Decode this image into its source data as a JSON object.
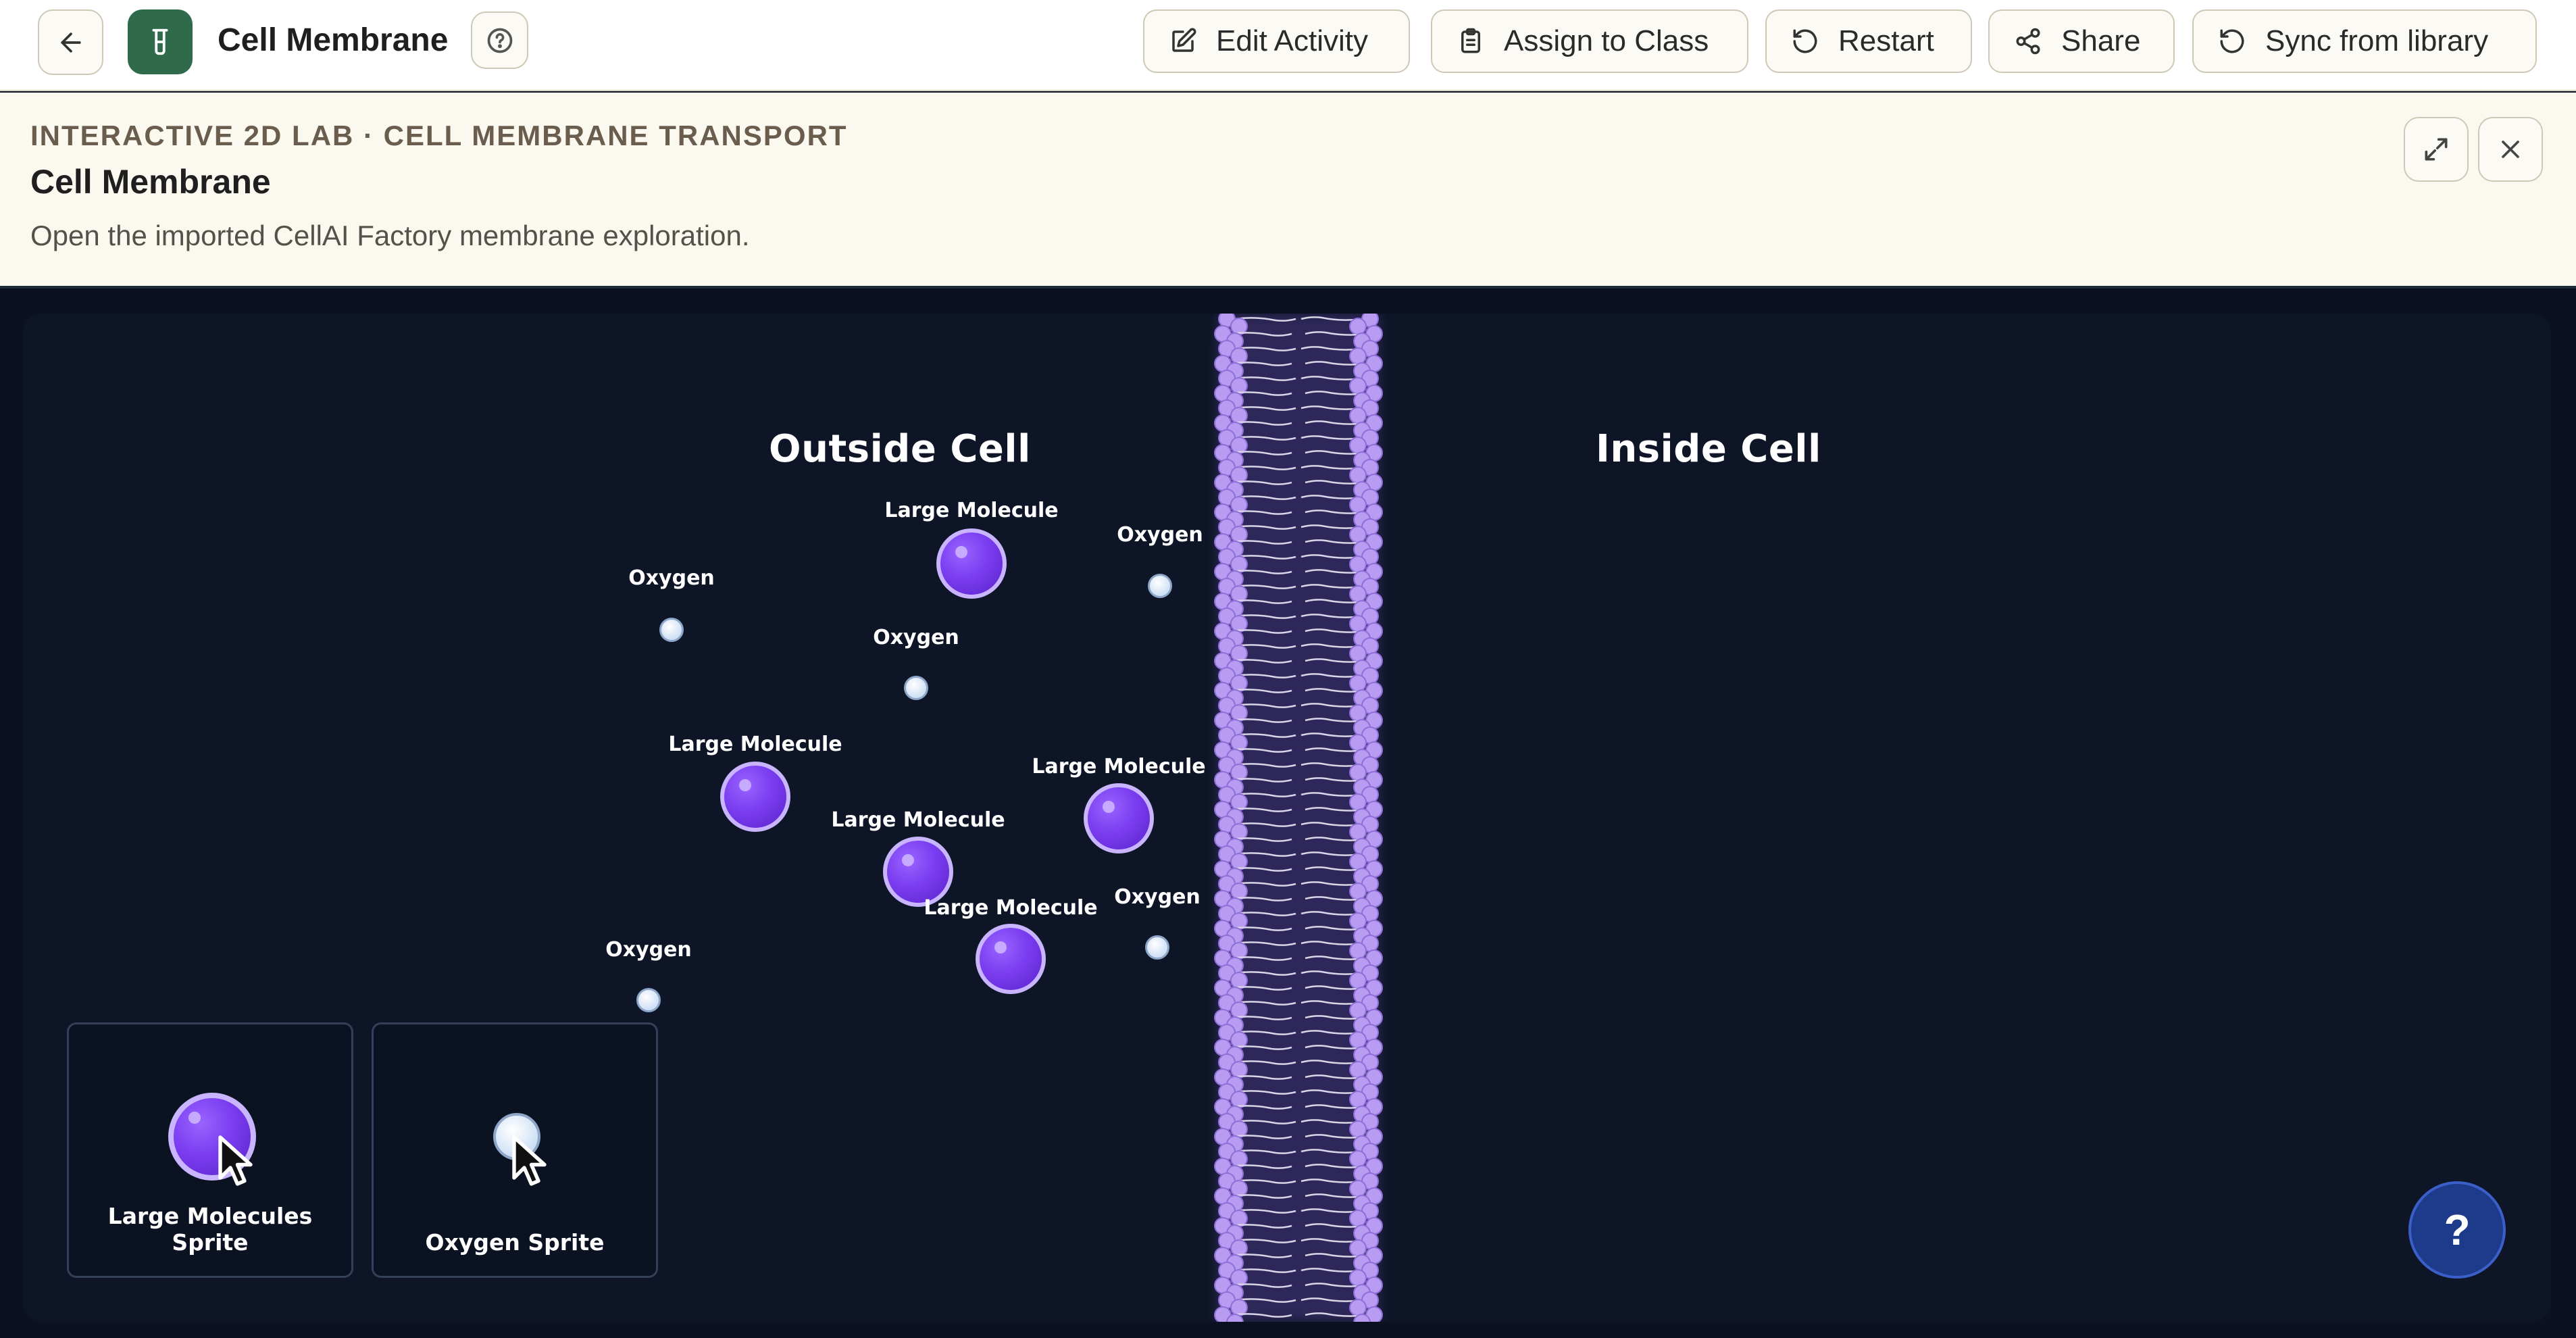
{
  "header": {
    "back_icon": "arrow-left-icon",
    "app_icon": "beaker-icon",
    "title": "Cell Membrane",
    "help_icon": "question-circle-icon",
    "actions": [
      {
        "label": "Edit Activity",
        "icon": "edit-icon"
      },
      {
        "label": "Assign to Class",
        "icon": "clipboard-icon"
      },
      {
        "label": "Restart",
        "icon": "restart-icon"
      },
      {
        "label": "Share",
        "icon": "share-icon"
      },
      {
        "label": "Sync from library",
        "icon": "sync-icon"
      }
    ]
  },
  "info": {
    "eyebrow": "INTERACTIVE 2D LAB · CELL MEMBRANE TRANSPORT",
    "title": "Cell Membrane",
    "description": "Open the imported CellAI Factory membrane exploration.",
    "expand_icon": "expand-icon",
    "close_icon": "close-icon"
  },
  "stage": {
    "outside_label": "Outside Cell",
    "inside_label": "Inside Cell",
    "molecules": [
      {
        "type": "large",
        "label": "Large Molecule"
      },
      {
        "type": "oxygen",
        "label": "Oxygen"
      },
      {
        "type": "oxygen",
        "label": "Oxygen"
      },
      {
        "type": "oxygen",
        "label": "Oxygen"
      },
      {
        "type": "large",
        "label": "Large Molecule"
      },
      {
        "type": "large",
        "label": "Large Molecule"
      },
      {
        "type": "large",
        "label": "Large Molecule"
      },
      {
        "type": "large",
        "label": "Large Molecule"
      },
      {
        "type": "oxygen",
        "label": "Oxygen"
      },
      {
        "type": "oxygen",
        "label": "Oxygen"
      }
    ],
    "palette": [
      {
        "label": "Large Molecules Sprite"
      },
      {
        "label": "Oxygen Sprite"
      }
    ],
    "help_button": "?",
    "colors": {
      "large_molecule": "#7a3df0",
      "oxygen": "#dbe7f6",
      "membrane": "#b79cf2",
      "background": "#0d1526"
    }
  }
}
